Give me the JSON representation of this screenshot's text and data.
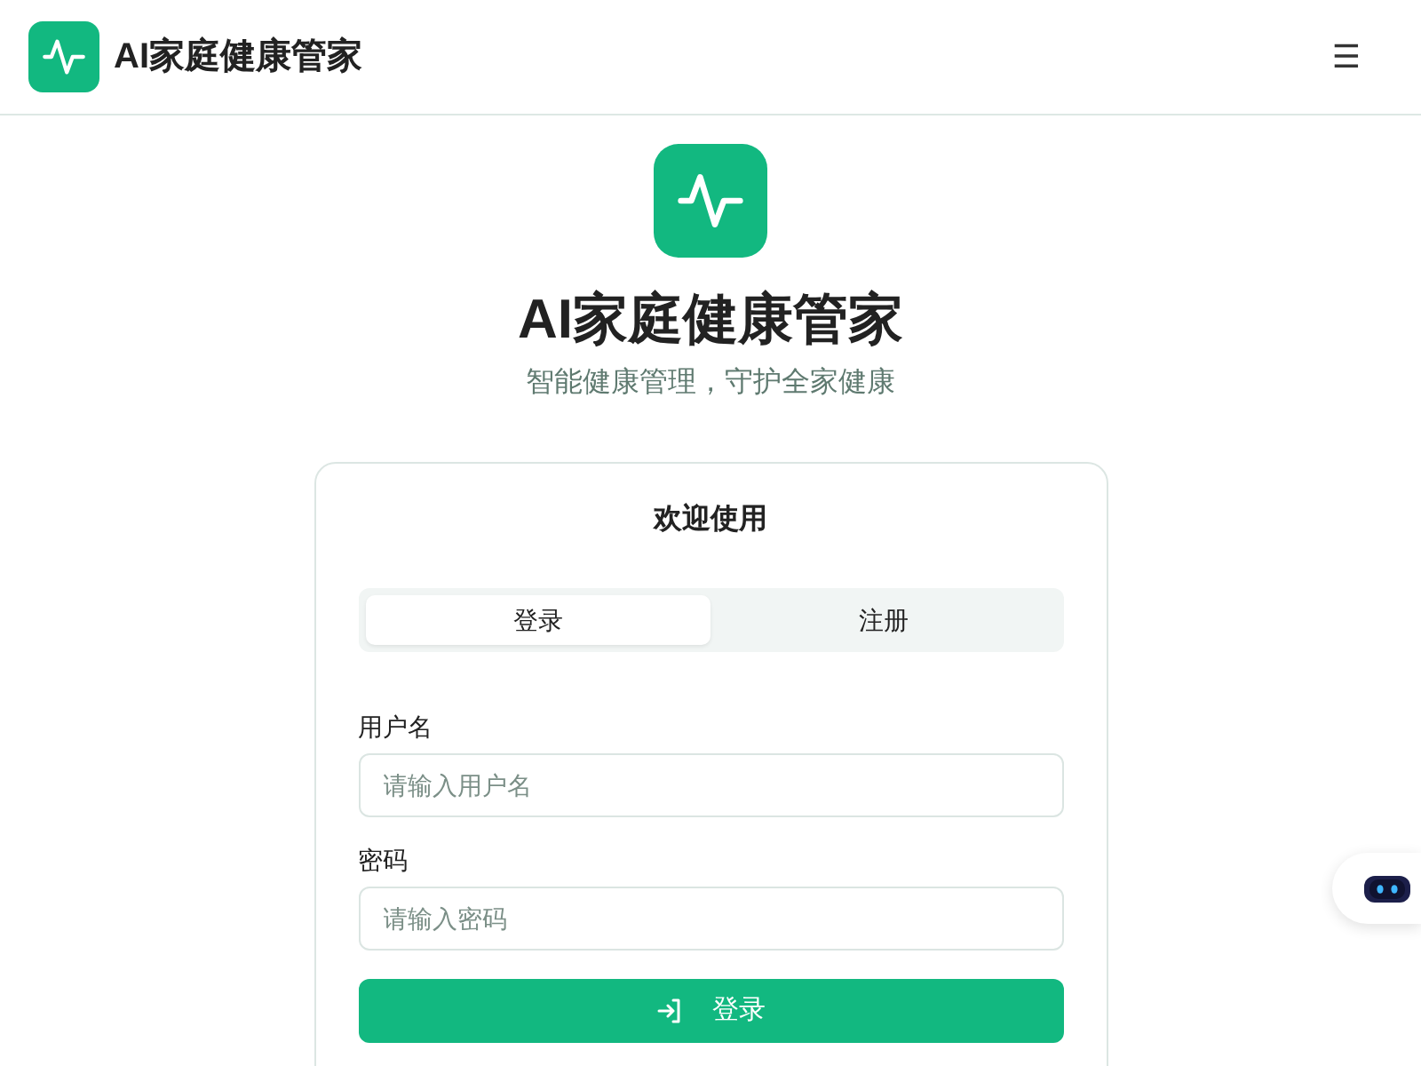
{
  "header": {
    "brand": "AI家庭健康管家",
    "menu_glyph": "☰"
  },
  "hero": {
    "title": "AI家庭健康管家",
    "subtitle": "智能健康管理，守护全家健康"
  },
  "card": {
    "title": "欢迎使用",
    "tabs": [
      {
        "label": "登录",
        "selected": true
      },
      {
        "label": "注册",
        "selected": false
      }
    ],
    "fields": [
      {
        "label": "用户名",
        "placeholder": "请输入用户名"
      },
      {
        "label": "密码",
        "placeholder": "请输入密码"
      }
    ],
    "submit": "登录"
  }
}
